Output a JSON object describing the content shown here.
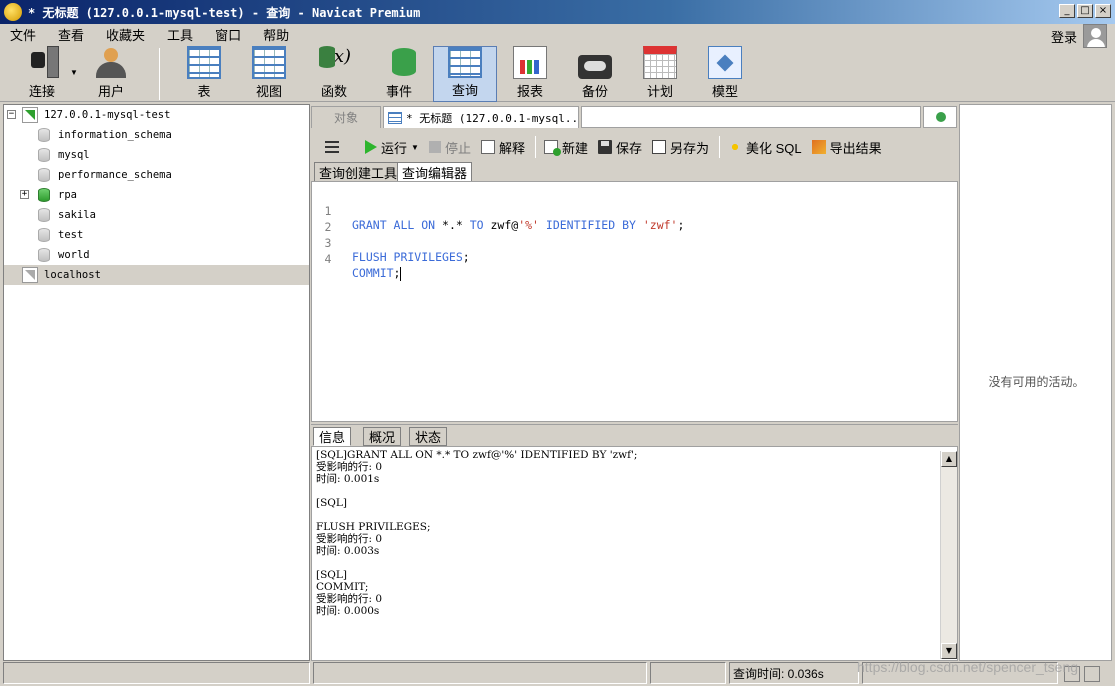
{
  "window": {
    "title": "* 无标题 (127.0.0.1-mysql-test) - 查询 - Navicat Premium",
    "buttons": [
      "_",
      "□",
      "×"
    ]
  },
  "menu": [
    "文件",
    "查看",
    "收藏夹",
    "工具",
    "窗口",
    "帮助"
  ],
  "login": {
    "label": "登录",
    "icon": "user-avatar-icon"
  },
  "toolbar": [
    {
      "label": "连接",
      "icon": "plug-icon"
    },
    {
      "label": "用户",
      "icon": "user-icon"
    },
    {
      "label": "表",
      "icon": "table-icon"
    },
    {
      "label": "视图",
      "icon": "view-icon"
    },
    {
      "label": "函数",
      "icon": "function-icon"
    },
    {
      "label": "事件",
      "icon": "event-icon"
    },
    {
      "label": "查询",
      "icon": "query-icon",
      "active": true
    },
    {
      "label": "报表",
      "icon": "report-icon"
    },
    {
      "label": "备份",
      "icon": "backup-icon"
    },
    {
      "label": "计划",
      "icon": "schedule-icon"
    },
    {
      "label": "模型",
      "icon": "model-icon"
    }
  ],
  "tree": {
    "connection": "127.0.0.1-mysql-test",
    "databases": [
      "information_schema",
      "mysql",
      "performance_schema",
      "rpa",
      "sakila",
      "test",
      "world"
    ],
    "other_connection": "localhost"
  },
  "tabs": {
    "objects": "对象",
    "query": "* 无标题 (127.0.0.1-mysql..."
  },
  "query_toolbar": {
    "run": "运行",
    "stop": "停止",
    "explain": "解释",
    "new": "新建",
    "save": "保存",
    "save_as": "另存为",
    "beautify": "美化 SQL",
    "export": "导出结果"
  },
  "sub_tabs": [
    "查询创建工具",
    "查询编辑器"
  ],
  "editor": {
    "lines": [
      {
        "num": "1"
      },
      {
        "num": "2"
      },
      {
        "num": "3"
      },
      {
        "num": "4"
      }
    ],
    "line1": {
      "kw1": "GRANT ALL ON",
      "mid": " *.* ",
      "kw2": "TO",
      "user": " zwf@",
      "host": "'%'",
      "kw3": " IDENTIFIED BY ",
      "pwd": "'zwf'",
      "end": ";"
    },
    "line3": {
      "kw": "FLUSH PRIVILEGES",
      "end": ";"
    },
    "line4": {
      "kw": "COMMIT",
      "end": ";"
    }
  },
  "result_tabs": [
    "信息",
    "概况",
    "状态"
  ],
  "messages": [
    "[SQL]GRANT ALL ON *.* TO zwf@'%' IDENTIFIED BY 'zwf';",
    "受影响的行: 0",
    "时间: 0.001s",
    "",
    "[SQL]",
    "",
    "FLUSH PRIVILEGES;",
    "受影响的行: 0",
    "时间: 0.003s",
    "",
    "[SQL]",
    "COMMIT;",
    "受影响的行: 0",
    "时间: 0.000s"
  ],
  "right_pane": {
    "empty_text": "没有可用的活动。"
  },
  "status": {
    "query_time": "查询时间: 0.036s",
    "watermark": "https://blog.csdn.net/spencer_tseng"
  }
}
